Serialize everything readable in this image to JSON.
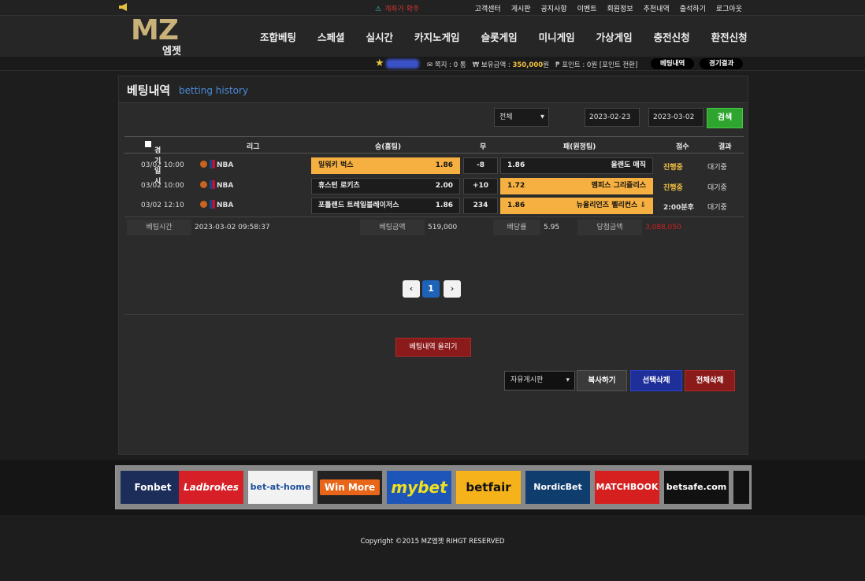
{
  "topbar": {
    "notice": "계좌가 확주",
    "links": [
      "고객센터",
      "게시판",
      "공지사항",
      "이벤트",
      "회원정보",
      "추천내역",
      "출석하기",
      "로그아웃"
    ]
  },
  "header": {
    "logo_main": "MZ",
    "logo_sub": "엠젯",
    "nav": [
      "조합베팅",
      "스페셜",
      "실시간",
      "카지노게임",
      "슬롯게임",
      "미니게임",
      "가상게임",
      "충전신청",
      "환전신청"
    ]
  },
  "userbar": {
    "note": "✉ 쪽지 : 0 통",
    "balance_label": "₩ 보유금액 : ",
    "balance": "350,000",
    "balance_unit": "원",
    "point": "₱ 포인트 : 0원 [포인트 전환]",
    "btn_history": "베팅내역",
    "btn_results": "경기결과"
  },
  "panel": {
    "title_ko": "베팅내역",
    "title_en": "betting history",
    "filter": "전체",
    "date_from": "2023-02-23",
    "date_to": "2023-03-02",
    "search": "검색"
  },
  "table": {
    "headers": [
      "경기일시",
      "리그",
      "승(홈팀)",
      "무",
      "패(원정팀)",
      "점수",
      "결과"
    ],
    "rows": [
      {
        "date": "03/02 10:00",
        "league": "NBA",
        "home": "밀워키 벅스",
        "home_odds": "1.86",
        "draw": "-8",
        "away": "올랜도 매직",
        "away_odds": "1.86",
        "pick": "home",
        "score": "진행중",
        "result": "대기중"
      },
      {
        "date": "03/02 10:00",
        "league": "NBA",
        "home": "휴스턴 로키츠",
        "home_odds": "2.00",
        "draw": "+10",
        "away": "멤피스 그리즐리스",
        "away_odds": "1.72",
        "pick": "away",
        "score": "진행중",
        "result": "대기중"
      },
      {
        "date": "03/02 12:10",
        "league": "NBA",
        "home": "포틀랜드 트레일블레이저스",
        "home_odds": "1.86",
        "draw": "234",
        "away": "뉴올리언즈 펠리컨스 ⇩",
        "away_odds": "1.86",
        "pick": "away",
        "score": "2:00분후",
        "result": "대기중"
      }
    ]
  },
  "summary": {
    "bet_time_label": "베팅시간",
    "bet_time": "2023-03-02 09:58:37",
    "bet_amount_label": "베팅금액",
    "bet_amount": "519,000",
    "odds_label": "배당률",
    "odds": "5.95",
    "win_label": "당첨금액",
    "win_amount": "3,088,050"
  },
  "pagination": {
    "prev": "‹",
    "current": "1",
    "next": "›"
  },
  "actions": {
    "upload": "베팅내역 올리기",
    "board": "자유게시판",
    "copy": "복사하기",
    "delete_selected": "선택삭제",
    "delete_all": "전체삭제"
  },
  "partners": [
    "Fonbet",
    "Ladbrokes",
    "bet-at-home",
    "Win More",
    "mybet",
    "betfair",
    "NordicBet",
    "MATCHBOOK",
    "betsafe.com"
  ],
  "footer": {
    "copyright": "Copyright ©2015 MZ엠젯 RIHGT RESERVED"
  }
}
